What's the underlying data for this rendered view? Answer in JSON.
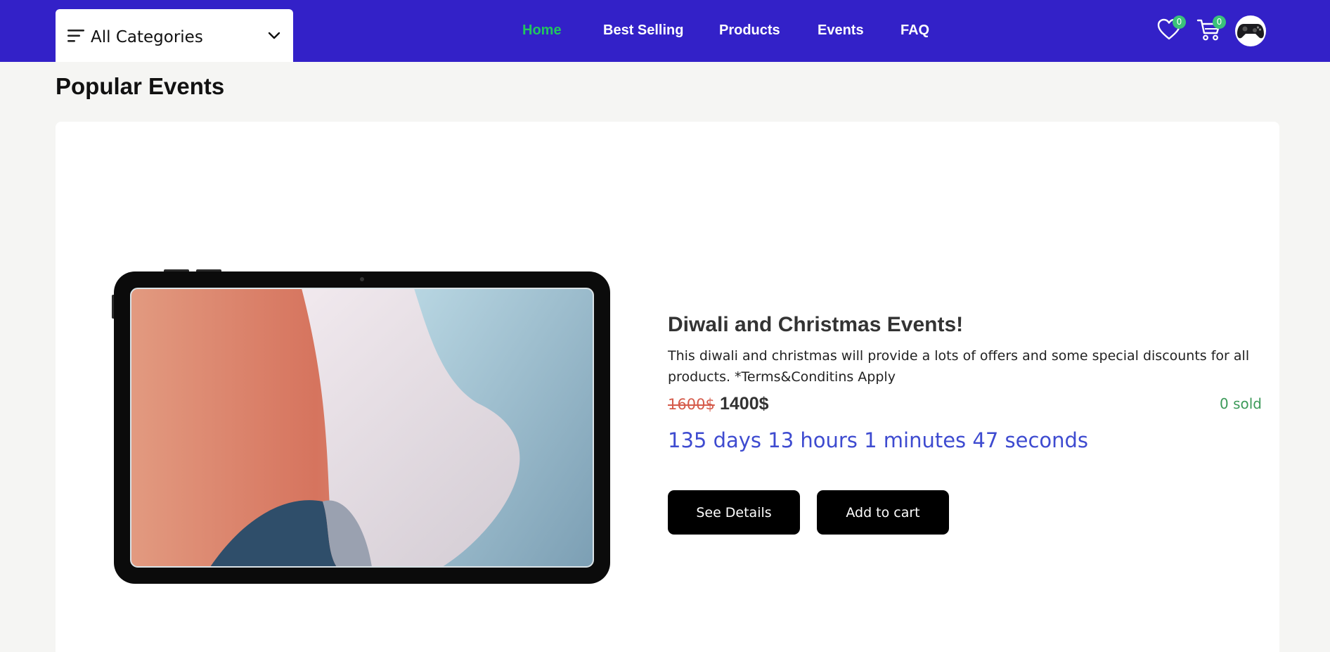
{
  "header": {
    "categories": {
      "label": "All Categories",
      "icon": "menu-icon",
      "dropdown_icon": "chevron-down-icon"
    },
    "nav": [
      {
        "label": "Home",
        "active": true
      },
      {
        "label": "Best Selling",
        "active": false
      },
      {
        "label": "Products",
        "active": false
      },
      {
        "label": "Events",
        "active": false
      },
      {
        "label": "FAQ",
        "active": false
      }
    ],
    "wishlist": {
      "icon": "heart-icon",
      "count": "0"
    },
    "cart": {
      "icon": "cart-icon",
      "count": "0"
    },
    "avatar": {
      "icon": "gamepad-avatar"
    }
  },
  "section": {
    "title": "Popular Events"
  },
  "event": {
    "title": "Diwali and Christmas Events!",
    "description": "This diwali and christmas will provide a lots of offers and some special discounts for all products. *Terms&Conditins Apply",
    "original_price": "1600$",
    "discount_price": "1400$",
    "sold": "0 sold",
    "countdown": "135 days 13 hours 1 minutes 47 seconds",
    "buttons": {
      "details": "See Details",
      "cart": "Add to cart"
    }
  },
  "colors": {
    "header_bg": "#3321c8",
    "nav_active": "#22c55e",
    "badge": "#3bc27a",
    "old_price": "#d55b4b",
    "countdown": "#3e4bd0",
    "sold": "#3c9a59",
    "button_bg": "#000000"
  }
}
